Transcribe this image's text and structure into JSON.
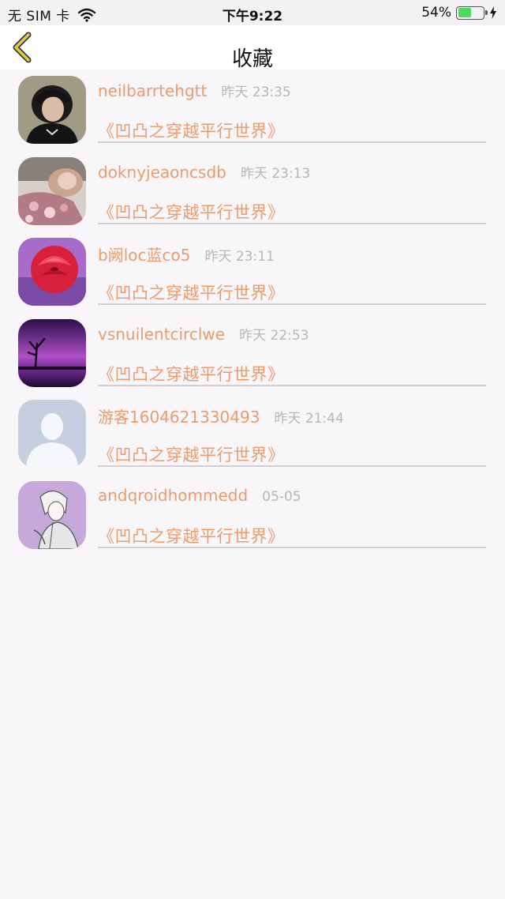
{
  "status_bar": {
    "carrier": "无 SIM 卡",
    "time": "下午9:22",
    "battery": "54%",
    "battery_level": 0.54
  },
  "nav": {
    "title": "收藏"
  },
  "items": [
    {
      "name": "neilbarrtehgtt",
      "time": "昨天 23:35",
      "title": "《凹凸之穿越平行世界》"
    },
    {
      "name": "doknyjeaoncsdb",
      "time": "昨天 23:13",
      "title": "《凹凸之穿越平行世界》"
    },
    {
      "name": "b阙loc蓝co5",
      "time": "昨天 23:11",
      "title": "《凹凸之穿越平行世界》"
    },
    {
      "name": "vsnuilentcirclwe",
      "time": "昨天 22:53",
      "title": "《凹凸之穿越平行世界》"
    },
    {
      "name": "游客1604621330493",
      "time": "昨天 21:44",
      "title": "《凹凸之穿越平行世界》"
    },
    {
      "name": "andqroidhommedd",
      "time": "05-05",
      "title": "《凹凸之穿越平行世界》"
    }
  ],
  "colors": {
    "accent": "#eb9b6c",
    "back_arrow": "#e4c84a",
    "secondary_text": "#b8b6b8"
  }
}
